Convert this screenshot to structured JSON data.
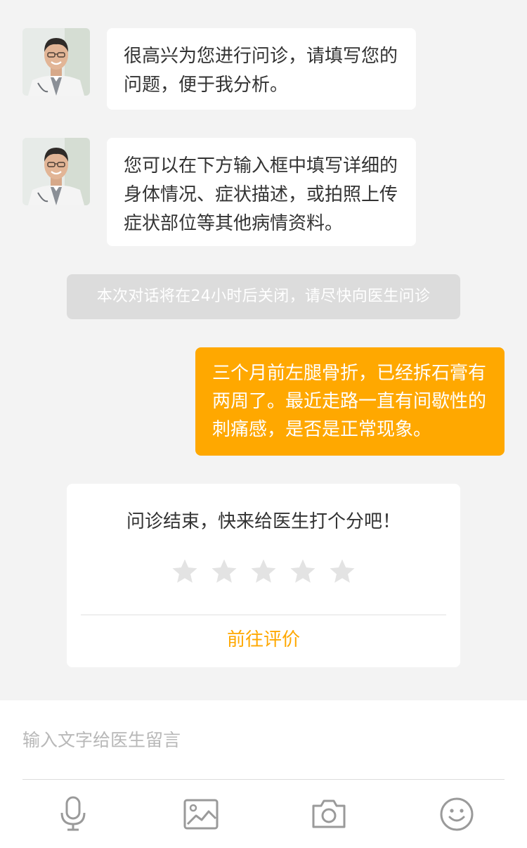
{
  "messages": {
    "doctor_1": "很高兴为您进行问诊，请填写您的问题，便于我分析。",
    "doctor_2": "您可以在下方输入框中填写详细的身体情况、症状描述，或拍照上传症状部位等其他病情资料。",
    "system_notice": "本次对话将在24小时后关闭，请尽快向医生问诊",
    "user_1": "三个月前左腿骨折，已经拆石膏有两周了。最近走路一直有间歇性的刺痛感，是否是正常现象。"
  },
  "rating": {
    "title": "问诊结束，快来给医生打个分吧！",
    "max_stars": 5,
    "current_stars": 0,
    "link_label": "前往评价"
  },
  "input": {
    "placeholder": "输入文字给医生留言",
    "value": ""
  },
  "toolbar": {
    "icons": [
      "microphone-icon",
      "image-icon",
      "camera-icon",
      "emoji-icon"
    ]
  },
  "colors": {
    "accent": "#ffa800",
    "background": "#f3f3f3",
    "notice_background": "#dcdcdc",
    "icon_gray": "#9a9a9a"
  }
}
